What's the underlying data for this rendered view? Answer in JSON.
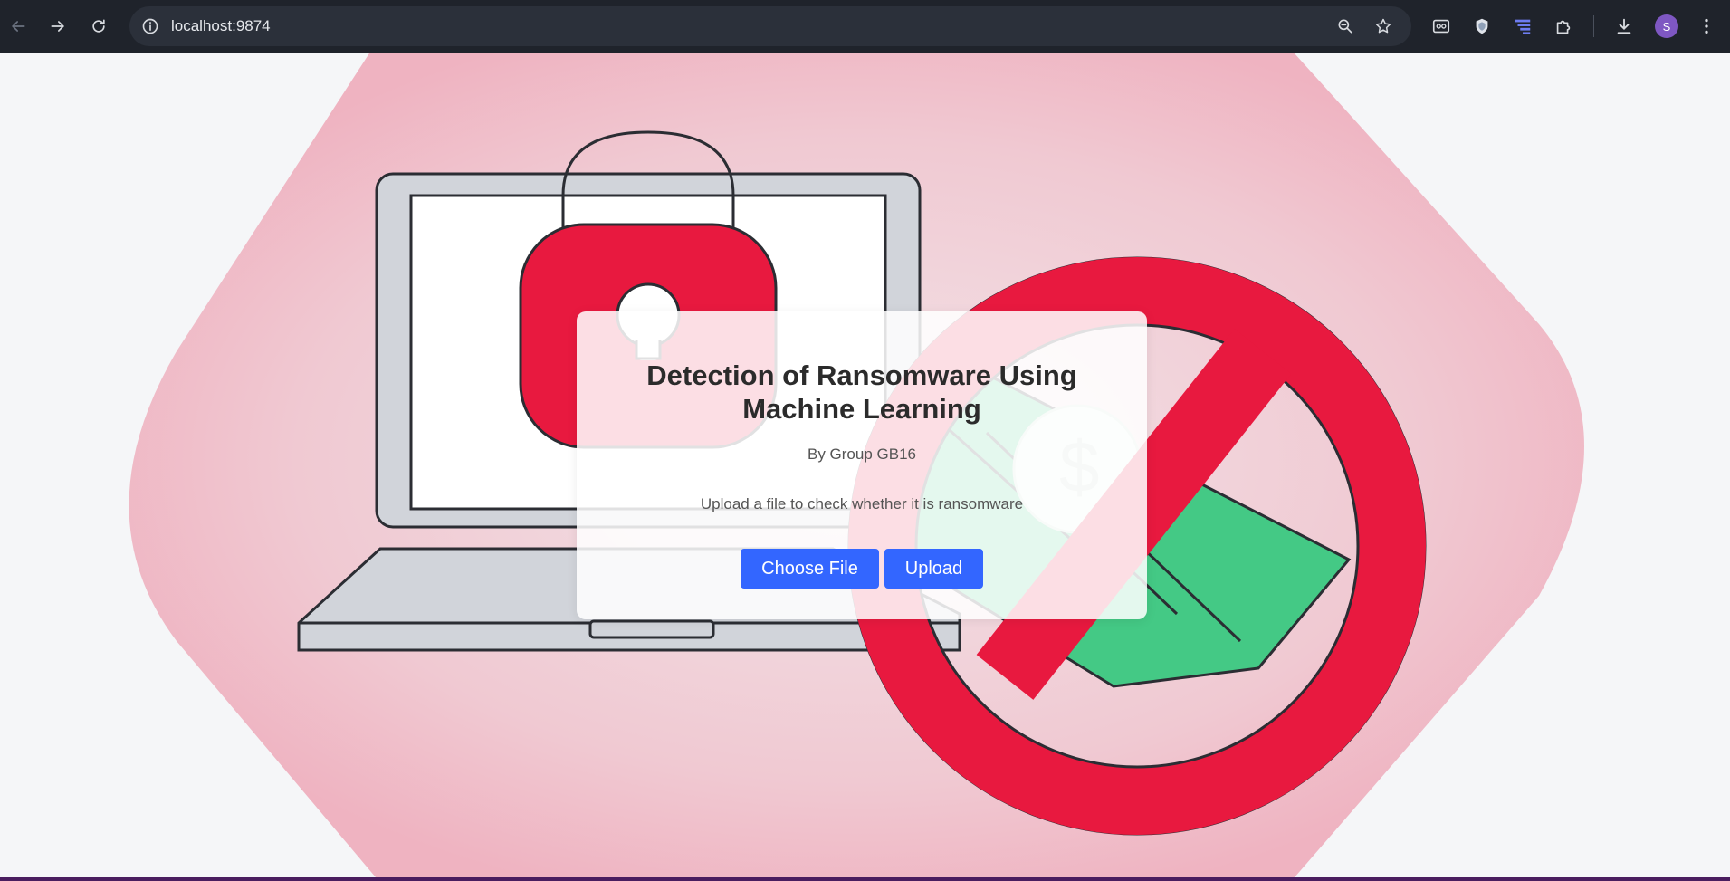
{
  "browser": {
    "url": "localhost:9874",
    "avatar_letter": "S",
    "icons": [
      "back-icon",
      "forward-icon",
      "reload-icon",
      "site-info-icon",
      "zoom-icon",
      "bookmark-star-icon",
      "extension-reader-icon",
      "extension-shield-icon",
      "extension-stack-icon",
      "extensions-puzzle-icon",
      "download-icon",
      "profile-avatar",
      "menu-kebab-icon"
    ]
  },
  "card": {
    "title": "Detection of Ransomware Using Machine Learning",
    "byline": "By Group GB16",
    "instruction": "Upload a file to check whether it is ransomware",
    "choose_file_label": "Choose File",
    "upload_label": "Upload"
  },
  "colors": {
    "accent_button": "#3366ff",
    "lock_red": "#e8193f",
    "money_green": "#44c985",
    "background_pink": "#f2b4c2"
  }
}
